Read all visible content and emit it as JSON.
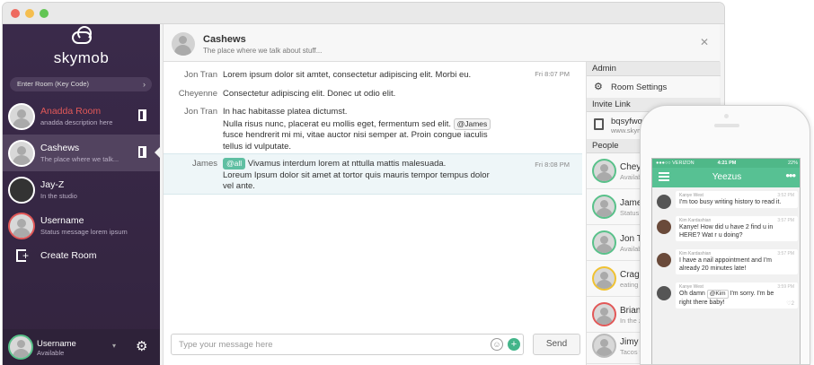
{
  "app": {
    "logo_text": "skymob",
    "room_input_placeholder": "Enter Room (Key Code)"
  },
  "sidebar": {
    "rooms": [
      {
        "name": "Anadda Room",
        "desc": "anadda description here"
      },
      {
        "name": "Cashews",
        "desc": "The place where we talk..."
      },
      {
        "name": "Jay-Z",
        "desc": "In the studio"
      },
      {
        "name": "Username",
        "desc": "Status message lorem ipsum"
      }
    ],
    "create_room_label": "Create Room",
    "me": {
      "name": "Username",
      "status": "Available"
    }
  },
  "chat": {
    "title": "Cashews",
    "subtitle": "The place where we talk about stuff...",
    "messages": [
      {
        "who": "Jon Tran",
        "line1": "Lorem ipsum dolor sit amtet, consectetur adipiscing elit. Morbi eu.",
        "time": "Fri 8:07 PM"
      },
      {
        "who": "Cheyenne",
        "line1": "Consectetur adipiscing elit. Donec ut odio elit."
      },
      {
        "who": "Jon Tran",
        "line1": "In hac habitasse platea dictumst.",
        "line2a": "Nulla risus nunc, placerat eu mollis eget, fermentum sed elit.",
        "mention": "@James",
        "line3": "fusce hendrerit mi mi, vitae auctor nisi semper at. Proin congue iaculis",
        "line4": "tellus id vulputate."
      },
      {
        "who": "James",
        "mention": "@all",
        "line1": "Vivamus interdum lorem at nttulla mattis malesuada.",
        "line2": "Loreum Ipsum dolor sit amet at tortor quis mauris tempor tempus dolor",
        "line3": "vel ante.",
        "time": "Fri 8:08 PM"
      }
    ],
    "composer_placeholder": "Type your message here",
    "send_label": "Send"
  },
  "panel": {
    "admin_header": "Admin",
    "room_settings_label": "Room Settings",
    "invite_header": "Invite Link",
    "invite_code": "bqsyfwq",
    "invite_url": "www.skym",
    "people_header": "People",
    "people": [
      {
        "name": "Cheyn",
        "status": "Availab"
      },
      {
        "name": "James",
        "status": "Status l"
      },
      {
        "name": "Jon Tr",
        "status": "Availab"
      },
      {
        "name": "Cragin",
        "status": "eating l"
      },
      {
        "name": "Brian",
        "status": "In the z"
      },
      {
        "name": "Jimy",
        "status": "Tacos t"
      }
    ]
  },
  "phone": {
    "carrier": "●●●○○ VERIZON",
    "clock": "4:21 PM",
    "battery": "22%",
    "title": "Yeezus",
    "messages": [
      {
        "sender": "Kanye West",
        "time": "3:52 PM",
        "text": "I'm too busy writing history to read it."
      },
      {
        "sender": "Kim Kardashian",
        "time": "3:57 PM",
        "text1": "Kanye! How did u have 2 find u in",
        "text2": "HERE? Wat r u doing?"
      },
      {
        "sender": "Kim Kardashian",
        "time": "3:57 PM",
        "text1": "I have a nail appointment and I'm",
        "text2": "already 20 minutes late!"
      },
      {
        "sender": "Kanye West",
        "time": "3:59 PM",
        "text1a": "Oh damn",
        "mention": "@Kim",
        "text1b": "I'm sorry. I'm be",
        "text2": "right there baby!"
      }
    ]
  },
  "colors": {
    "sidebar_bg": "#3a2a4a",
    "accent_green": "#57c193",
    "alert_red": "#e25858"
  }
}
